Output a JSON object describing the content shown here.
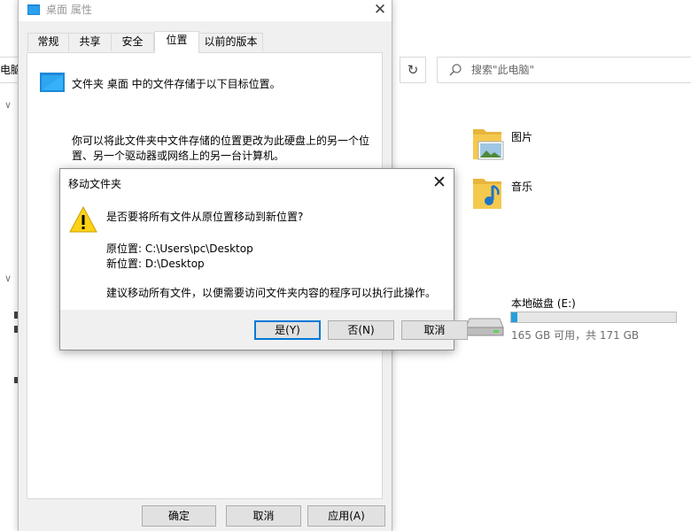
{
  "explorer": {
    "address_fragment": "电脑",
    "refresh_symbol": "↻",
    "search_placeholder": "搜索\"此电脑\"",
    "folders": [
      {
        "label": "图片"
      },
      {
        "label": "音乐"
      }
    ],
    "drive": {
      "name": "本地磁盘 (E:)",
      "free_text": "165 GB 可用，共 171 GB",
      "used_fraction": 0.035
    }
  },
  "properties": {
    "title": "桌面 属性",
    "tabs": [
      {
        "label": "常规"
      },
      {
        "label": "共享"
      },
      {
        "label": "安全"
      },
      {
        "label": "位置"
      },
      {
        "label": "以前的版本"
      }
    ],
    "active_tab": "位置",
    "location_desc": "文件夹 桌面 中的文件存储于以下目标位置。",
    "move_desc": "你可以将此文件夹中文件存储的位置更改为此硬盘上的另一个位置、另一个驱动器或网络上的另一台计算机。",
    "buttons": {
      "ok": "确定",
      "cancel": "取消",
      "apply": "应用(A)"
    }
  },
  "move_dialog": {
    "title": "移动文件夹",
    "question": "是否要将所有文件从原位置移动到新位置?",
    "original": "原位置: C:\\Users\\pc\\Desktop",
    "new": "新位置: D:\\Desktop",
    "advice": "建议移动所有文件，以便需要访问文件夹内容的程序可以执行此操作。",
    "buttons": {
      "yes": "是(Y)",
      "no": "否(N)",
      "cancel": "取消"
    }
  },
  "colors": {
    "accent": "#0078d7",
    "drive_fill": "#26a0da",
    "folder_yellow": "#f4c94e"
  }
}
